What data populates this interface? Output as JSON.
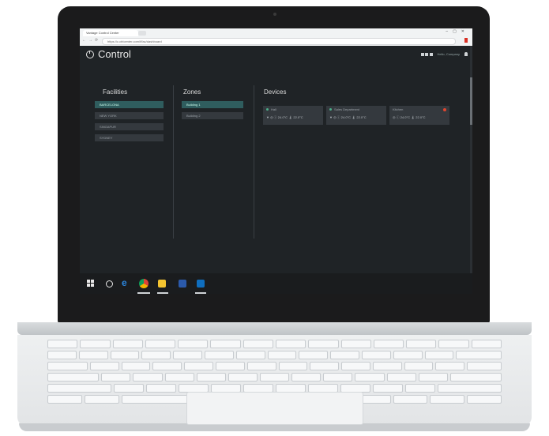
{
  "app": {
    "title": "Control"
  },
  "browser": {
    "tab_title": "Vantage Control Center",
    "address": "https://c.ctrlcenter.com/f/fac/dashboard"
  },
  "columns": {
    "facilities": {
      "header": "Facilities",
      "items": [
        "BARCELONA",
        "NEW YORK",
        "SINGAPUR",
        "SYDNEY"
      ],
      "selected": "BARCELONA"
    },
    "zones": {
      "header": "Zones",
      "items": [
        "Building 1",
        "Building 2"
      ],
      "selected": "Building 1"
    },
    "devices": {
      "header": "Devices",
      "cards": [
        {
          "name": "Hall",
          "stats": "▼ ◎ ⓘ 24.0°C 🌡 22.0°C",
          "alert": false
        },
        {
          "name": "Sales Department",
          "stats": "▼ ◎ ⓘ 24.0°C 🌡 22.0°C",
          "alert": false
        },
        {
          "name": "Kitchen",
          "stats": "◎ ⓘ 24.0°C 🌡 22.0°C",
          "alert": true
        }
      ]
    }
  },
  "topright": {
    "label": "Hello, Company"
  },
  "icons": {
    "app": "power-icon",
    "grid": "grid-icon",
    "user": "user-icon"
  },
  "colors": {
    "accent": "#2f5d5e",
    "alert": "#e0462f",
    "background": "#1f2326"
  }
}
